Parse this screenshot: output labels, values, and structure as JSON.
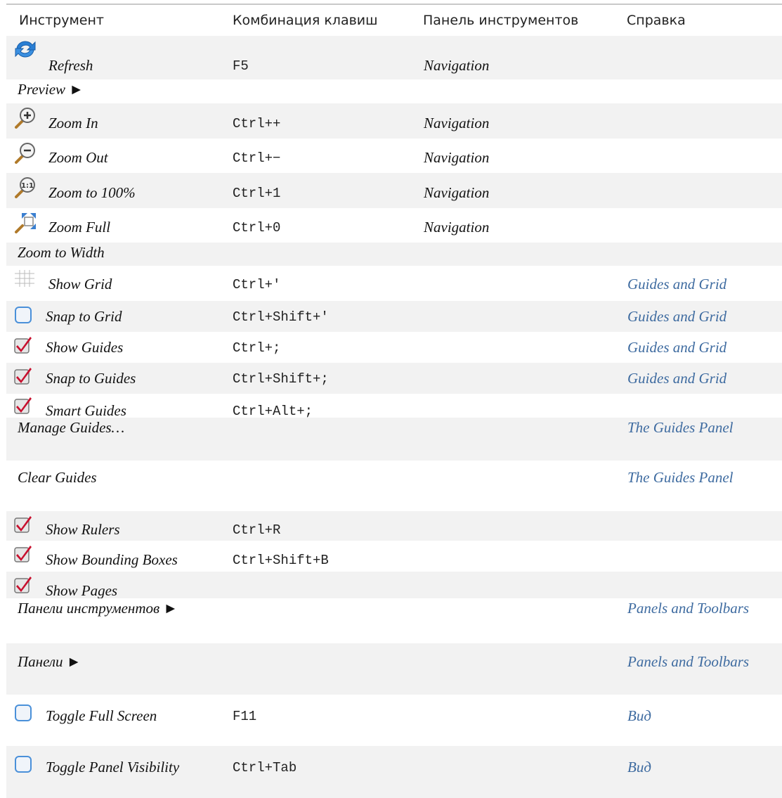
{
  "header": {
    "col_tool": "Инструмент",
    "col_shortcut": "Комбинация клавиш",
    "col_toolbar": "Панель инструментов",
    "col_help": "Справка"
  },
  "rows": [
    {
      "tool": "Refresh",
      "shortcut": "F5",
      "toolbar": "Navigation",
      "help": "",
      "icon": "refresh-icon"
    },
    {
      "tool": "Preview ►",
      "shortcut": "",
      "toolbar": "",
      "help": "",
      "icon": ""
    },
    {
      "tool": "Zoom In",
      "shortcut": "Ctrl++",
      "toolbar": "Navigation",
      "help": "",
      "icon": "zoom-in-icon"
    },
    {
      "tool": "Zoom Out",
      "shortcut": "Ctrl+−",
      "toolbar": "Navigation",
      "help": "",
      "icon": "zoom-out-icon"
    },
    {
      "tool": "Zoom to 100%",
      "shortcut": "Ctrl+1",
      "toolbar": "Navigation",
      "help": "",
      "icon": "zoom-100-icon"
    },
    {
      "tool": "Zoom Full",
      "shortcut": "Ctrl+0",
      "toolbar": "Navigation",
      "help": "",
      "icon": "zoom-full-icon"
    },
    {
      "tool": "Zoom to Width",
      "shortcut": "",
      "toolbar": "",
      "help": "",
      "icon": ""
    },
    {
      "tool": "Show Grid",
      "shortcut": "Ctrl+'",
      "toolbar": "",
      "help": "Guides and Grid",
      "icon": "grid-icon"
    },
    {
      "tool": "Snap to Grid",
      "shortcut": "Ctrl+Shift+'",
      "toolbar": "",
      "help": "Guides and Grid",
      "icon": "checkbox-unchecked-icon"
    },
    {
      "tool": "Show Guides",
      "shortcut": "Ctrl+;",
      "toolbar": "",
      "help": "Guides and Grid",
      "icon": "checkbox-checked-icon"
    },
    {
      "tool": "Snap to Guides",
      "shortcut": "Ctrl+Shift+;",
      "toolbar": "",
      "help": "Guides and Grid",
      "icon": "checkbox-checked-icon"
    },
    {
      "tool": "Smart Guides",
      "shortcut": "Ctrl+Alt+;",
      "toolbar": "",
      "help": "",
      "icon": "checkbox-checked-icon"
    },
    {
      "tool": "Manage Guides…",
      "shortcut": "",
      "toolbar": "",
      "help": "The Guides Panel",
      "icon": ""
    },
    {
      "tool": "Clear Guides",
      "shortcut": "",
      "toolbar": "",
      "help": "The Guides Panel",
      "icon": ""
    },
    {
      "tool": "Show Rulers",
      "shortcut": "Ctrl+R",
      "toolbar": "",
      "help": "",
      "icon": "checkbox-checked-icon"
    },
    {
      "tool": "Show Bounding Boxes",
      "shortcut": "Ctrl+Shift+B",
      "toolbar": "",
      "help": "",
      "icon": "checkbox-checked-icon"
    },
    {
      "tool": "Show Pages",
      "shortcut": "",
      "toolbar": "",
      "help": "",
      "icon": "checkbox-checked-icon"
    },
    {
      "tool": "Панели инструментов ►",
      "shortcut": "",
      "toolbar": "",
      "help": "Panels and Toolbars",
      "icon": ""
    },
    {
      "tool": "Панели ►",
      "shortcut": "",
      "toolbar": "",
      "help": "Panels and Toolbars",
      "icon": ""
    },
    {
      "tool": "Toggle Full Screen",
      "shortcut": "F11",
      "toolbar": "",
      "help": "Вид",
      "icon": "checkbox-unchecked-icon"
    },
    {
      "tool": "Toggle Panel Visibility",
      "shortcut": "Ctrl+Tab",
      "toolbar": "",
      "help": "Вид",
      "icon": "checkbox-unchecked-icon"
    }
  ],
  "colors": {
    "link": "#3e6ba0",
    "stripe": "#f2f2f2",
    "checkbox_border": "#4a90d9",
    "checkmark": "#c8102e"
  }
}
